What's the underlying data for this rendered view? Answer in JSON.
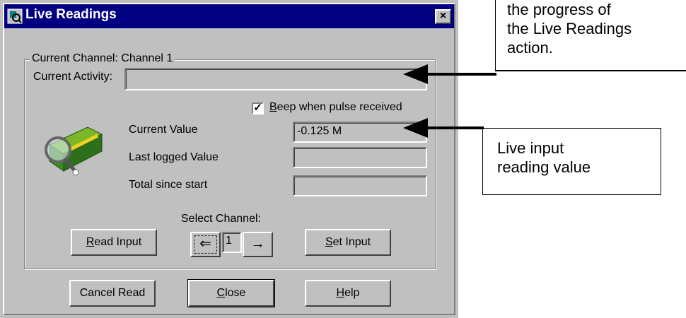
{
  "window": {
    "title": "Live Readings",
    "close_glyph": "×"
  },
  "group": {
    "legend_label": "Current Channel:",
    "legend_value": "Channel 1"
  },
  "activity": {
    "label": "Current Activity:",
    "value": ""
  },
  "beep": {
    "checked": true,
    "label_rest": "eep when pulse received",
    "label_access_key": "B"
  },
  "readings": {
    "current_value_label": "Current Value",
    "current_value": "-0.125 M",
    "last_logged_label": "Last logged Value",
    "last_logged_value": "",
    "total_label": "Total since start",
    "total_value": ""
  },
  "channel_select": {
    "label": "Select Channel:",
    "value": "1",
    "prev_icon": "left-arrow-icon",
    "next_icon": "right-arrow-icon"
  },
  "buttons": {
    "read_input_key": "R",
    "read_input_rest": "ead Input",
    "set_input_key": "S",
    "set_input_rest": "et Input",
    "cancel_read": "Cancel Read",
    "close_key": "C",
    "close_rest": "lose",
    "help_key": "H",
    "help_rest": "elp"
  },
  "callouts": {
    "progress_lines": [
      "the progress  of",
      "the Live Readings",
      "action."
    ],
    "live_input_lines": [
      "Live input",
      "reading value"
    ]
  },
  "colors": {
    "titlebar": "#000080",
    "dialog_face": "#c0c0c0"
  }
}
